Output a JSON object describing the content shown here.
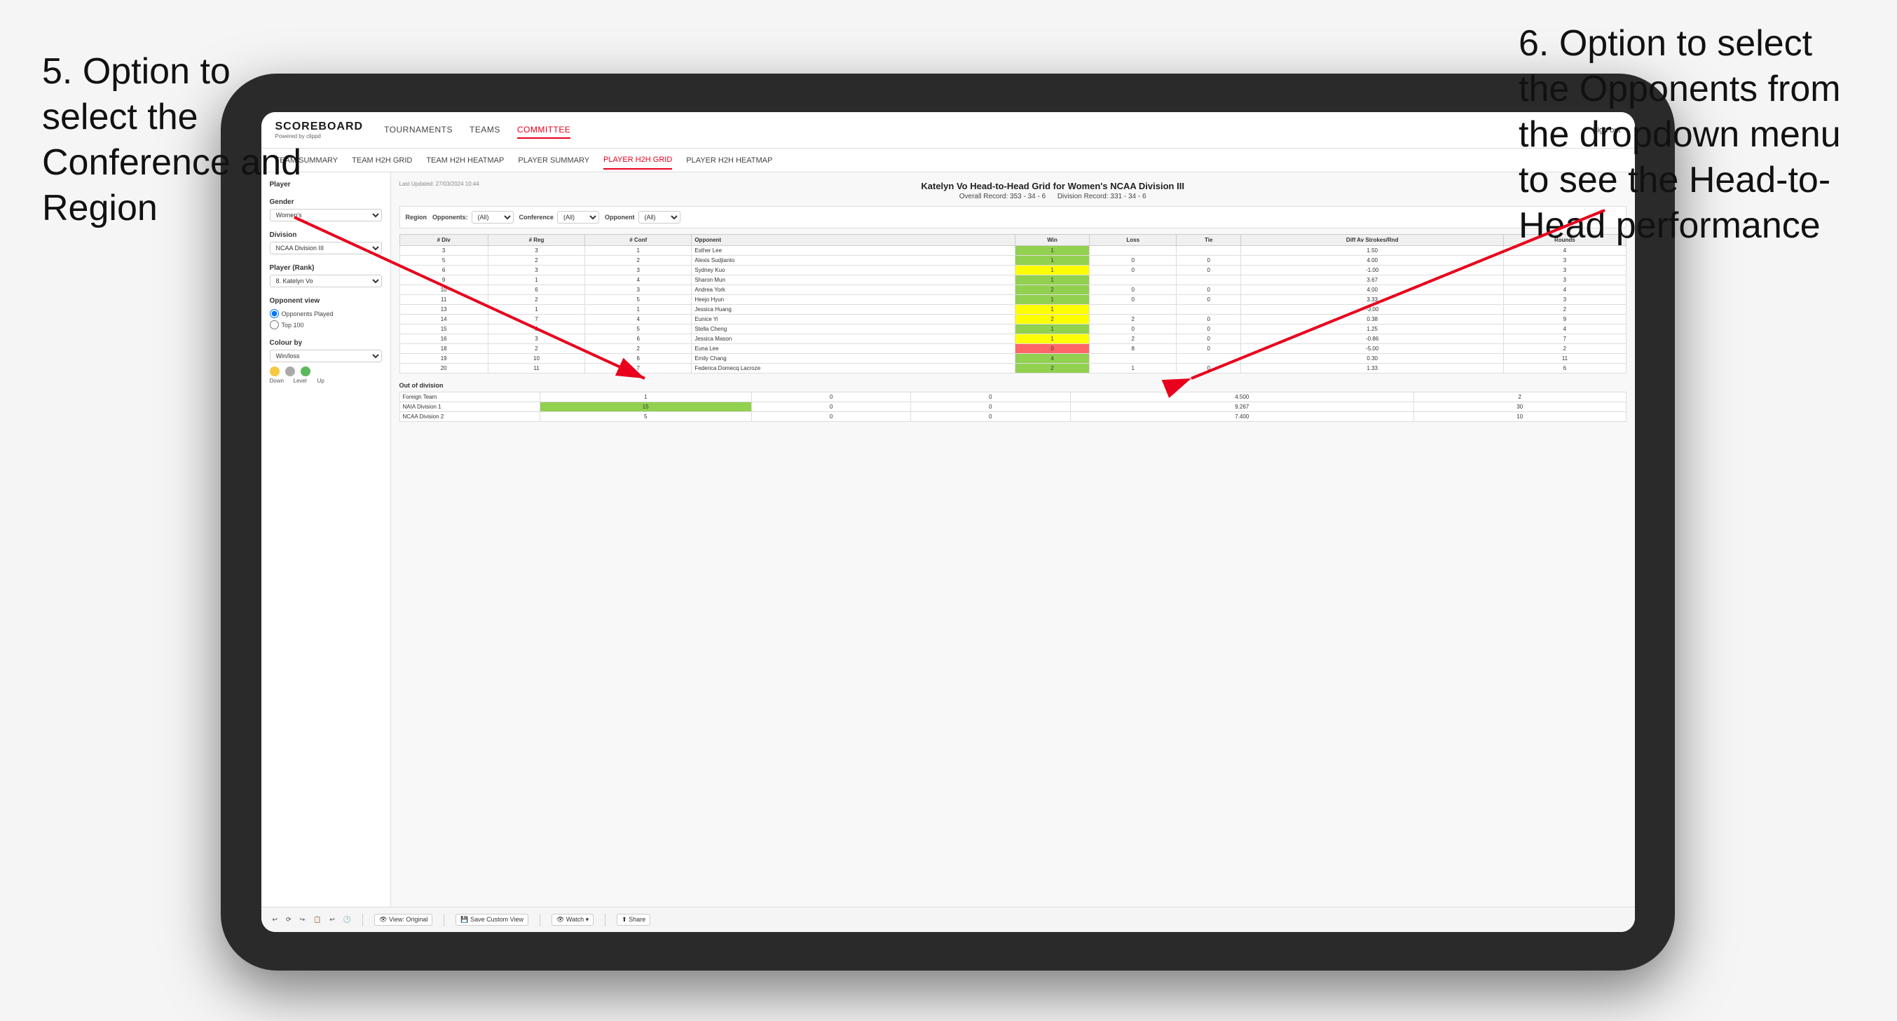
{
  "annotations": {
    "left_title": "5. Option to select the Conference and Region",
    "right_title": "6. Option to select the Opponents from the dropdown menu to see the Head-to-Head performance"
  },
  "nav": {
    "logo": "SCOREBOARD",
    "logo_sub": "Powered by clippd",
    "items": [
      "TOURNAMENTS",
      "TEAMS",
      "COMMITTEE"
    ],
    "active_item": "COMMITTEE",
    "sign_out": "Sign out"
  },
  "sub_nav": {
    "items": [
      "TEAM SUMMARY",
      "TEAM H2H GRID",
      "TEAM H2H HEATMAP",
      "PLAYER SUMMARY",
      "PLAYER H2H GRID",
      "PLAYER H2H HEATMAP"
    ],
    "active": "PLAYER H2H GRID"
  },
  "sidebar": {
    "player_label": "Player",
    "gender_label": "Gender",
    "gender_value": "Women's",
    "division_label": "Division",
    "division_value": "NCAA Division III",
    "player_rank_label": "Player (Rank)",
    "player_rank_value": "8. Katelyn Vo",
    "opponent_view_label": "Opponent view",
    "radio_1": "Opponents Played",
    "radio_2": "Top 100",
    "colour_by_label": "Colour by",
    "colour_by_value": "Win/loss",
    "legend": [
      "Down",
      "Level",
      "Up"
    ]
  },
  "report": {
    "last_updated": "Last Updated: 27/03/2024 10:44",
    "title": "Katelyn Vo Head-to-Head Grid for Women's NCAA Division III",
    "overall_record": "Overall Record: 353 - 34 - 6",
    "division_record": "Division Record: 331 - 34 - 6",
    "filter_opponents_label": "Opponents:",
    "filter_opponents_value": "(All)",
    "filter_conference_label": "Conference",
    "filter_conference_value": "(All)",
    "filter_opponent_label": "Opponent",
    "filter_opponent_value": "(All)",
    "table_headers": [
      "# Div",
      "# Reg",
      "# Conf",
      "Opponent",
      "Win",
      "Loss",
      "Tie",
      "Diff Av Strokes/Rnd",
      "Rounds"
    ],
    "rows": [
      {
        "div": "3",
        "reg": "3",
        "conf": "1",
        "opponent": "Esther Lee",
        "win": "1",
        "loss": "",
        "tie": "",
        "diff": "1.50",
        "rounds": "4",
        "win_color": "green"
      },
      {
        "div": "5",
        "reg": "2",
        "conf": "2",
        "opponent": "Alexis Sudjianto",
        "win": "1",
        "loss": "0",
        "tie": "0",
        "diff": "4.00",
        "rounds": "3",
        "win_color": "green"
      },
      {
        "div": "6",
        "reg": "3",
        "conf": "3",
        "opponent": "Sydney Kuo",
        "win": "1",
        "loss": "0",
        "tie": "0",
        "diff": "-1.00",
        "rounds": "3",
        "win_color": "yellow"
      },
      {
        "div": "9",
        "reg": "1",
        "conf": "4",
        "opponent": "Sharon Mun",
        "win": "1",
        "loss": "",
        "tie": "",
        "diff": "3.67",
        "rounds": "3",
        "win_color": "green"
      },
      {
        "div": "10",
        "reg": "6",
        "conf": "3",
        "opponent": "Andrea York",
        "win": "2",
        "loss": "0",
        "tie": "0",
        "diff": "4.00",
        "rounds": "4",
        "win_color": "green"
      },
      {
        "div": "11",
        "reg": "2",
        "conf": "5",
        "opponent": "Heejo Hyun",
        "win": "1",
        "loss": "0",
        "tie": "0",
        "diff": "3.33",
        "rounds": "3",
        "win_color": "green"
      },
      {
        "div": "13",
        "reg": "1",
        "conf": "1",
        "opponent": "Jessica Huang",
        "win": "1",
        "loss": "",
        "tie": "",
        "diff": "-3.00",
        "rounds": "2",
        "win_color": "yellow"
      },
      {
        "div": "14",
        "reg": "7",
        "conf": "4",
        "opponent": "Eunice Yi",
        "win": "2",
        "loss": "2",
        "tie": "0",
        "diff": "0.38",
        "rounds": "9",
        "win_color": "yellow"
      },
      {
        "div": "15",
        "reg": "8",
        "conf": "5",
        "opponent": "Stella Cheng",
        "win": "1",
        "loss": "0",
        "tie": "0",
        "diff": "1.25",
        "rounds": "4",
        "win_color": "green"
      },
      {
        "div": "16",
        "reg": "3",
        "conf": "6",
        "opponent": "Jessica Mason",
        "win": "1",
        "loss": "2",
        "tie": "0",
        "diff": "-0.86",
        "rounds": "7",
        "win_color": "yellow"
      },
      {
        "div": "18",
        "reg": "2",
        "conf": "2",
        "opponent": "Euna Lee",
        "win": "0",
        "loss": "8",
        "tie": "0",
        "diff": "-5.00",
        "rounds": "2",
        "win_color": "red"
      },
      {
        "div": "19",
        "reg": "10",
        "conf": "6",
        "opponent": "Emily Chang",
        "win": "4",
        "loss": "",
        "tie": "",
        "diff": "0.30",
        "rounds": "11",
        "win_color": "green"
      },
      {
        "div": "20",
        "reg": "11",
        "conf": "7",
        "opponent": "Federica Domecq Lacroze",
        "win": "2",
        "loss": "1",
        "tie": "0",
        "diff": "1.33",
        "rounds": "6",
        "win_color": "green"
      }
    ],
    "out_of_division_label": "Out of division",
    "out_of_division_rows": [
      {
        "name": "Foreign Team",
        "win": "1",
        "loss": "0",
        "tie": "0",
        "diff": "4.500",
        "rounds": "2",
        "color": ""
      },
      {
        "name": "NAIA Division 1",
        "win": "15",
        "loss": "0",
        "tie": "0",
        "diff": "9.267",
        "rounds": "30",
        "color": "green"
      },
      {
        "name": "NCAA Division 2",
        "win": "5",
        "loss": "0",
        "tie": "0",
        "diff": "7.400",
        "rounds": "10",
        "color": ""
      }
    ]
  },
  "toolbar": {
    "buttons": [
      "View: Original",
      "Save Custom View",
      "Watch ▾",
      "Share"
    ]
  }
}
